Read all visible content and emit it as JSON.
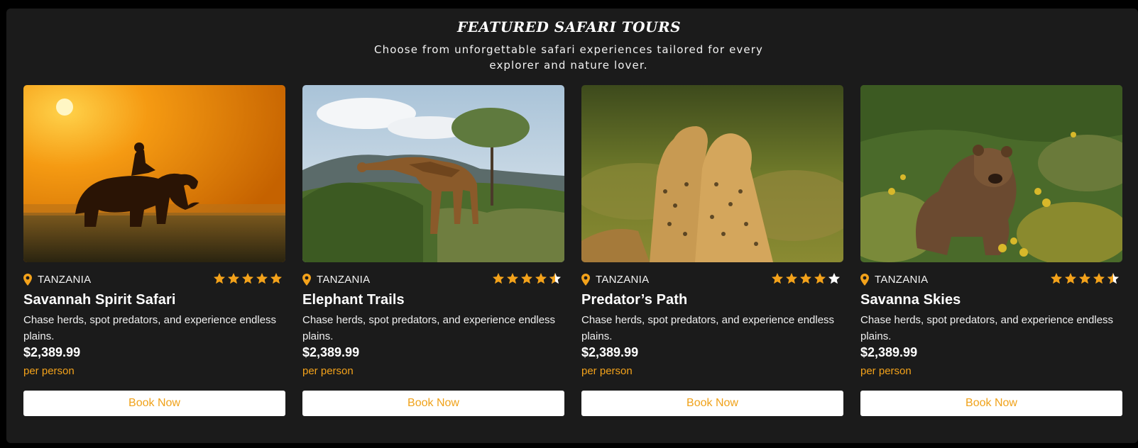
{
  "section": {
    "title": "FEATURED SAFARI TOURS",
    "subtitle": "Choose from unforgettable safari experiences tailored for every explorer and nature lover."
  },
  "colors": {
    "background": "#1b1b1b",
    "accent": "#f3a21b",
    "button_background": "#ffffff",
    "text": "#ffffff"
  },
  "tours": [
    {
      "location": "TANZANIA",
      "rating": 5,
      "title": "Savannah Spirit Safari",
      "description": "Chase herds, spot predators, and experience endless plains.",
      "price": "$2,389.99",
      "price_unit": "per person",
      "button_label": "Book Now",
      "image": "elephant-with-rider-at-sunset"
    },
    {
      "location": "TANZANIA",
      "rating": 4.5,
      "title": "Elephant Trails",
      "description": "Chase herds, spot predators, and experience endless plains.",
      "price": "$2,389.99",
      "price_unit": "per person",
      "button_label": "Book Now",
      "image": "giraffe-browsing-acacia"
    },
    {
      "location": "TANZANIA",
      "rating": 4,
      "title": "Predator’s Path",
      "description": "Chase herds, spot predators, and experience endless plains.",
      "price": "$2,389.99",
      "price_unit": "per person",
      "button_label": "Book Now",
      "image": "two-cheetahs-in-grass"
    },
    {
      "location": "TANZANIA",
      "rating": 4.5,
      "title": "Savanna Skies",
      "description": "Chase herds, spot predators, and experience endless plains.",
      "price": "$2,389.99",
      "price_unit": "per person",
      "button_label": "Book Now",
      "image": "brown-bear-in-shrubland"
    }
  ]
}
